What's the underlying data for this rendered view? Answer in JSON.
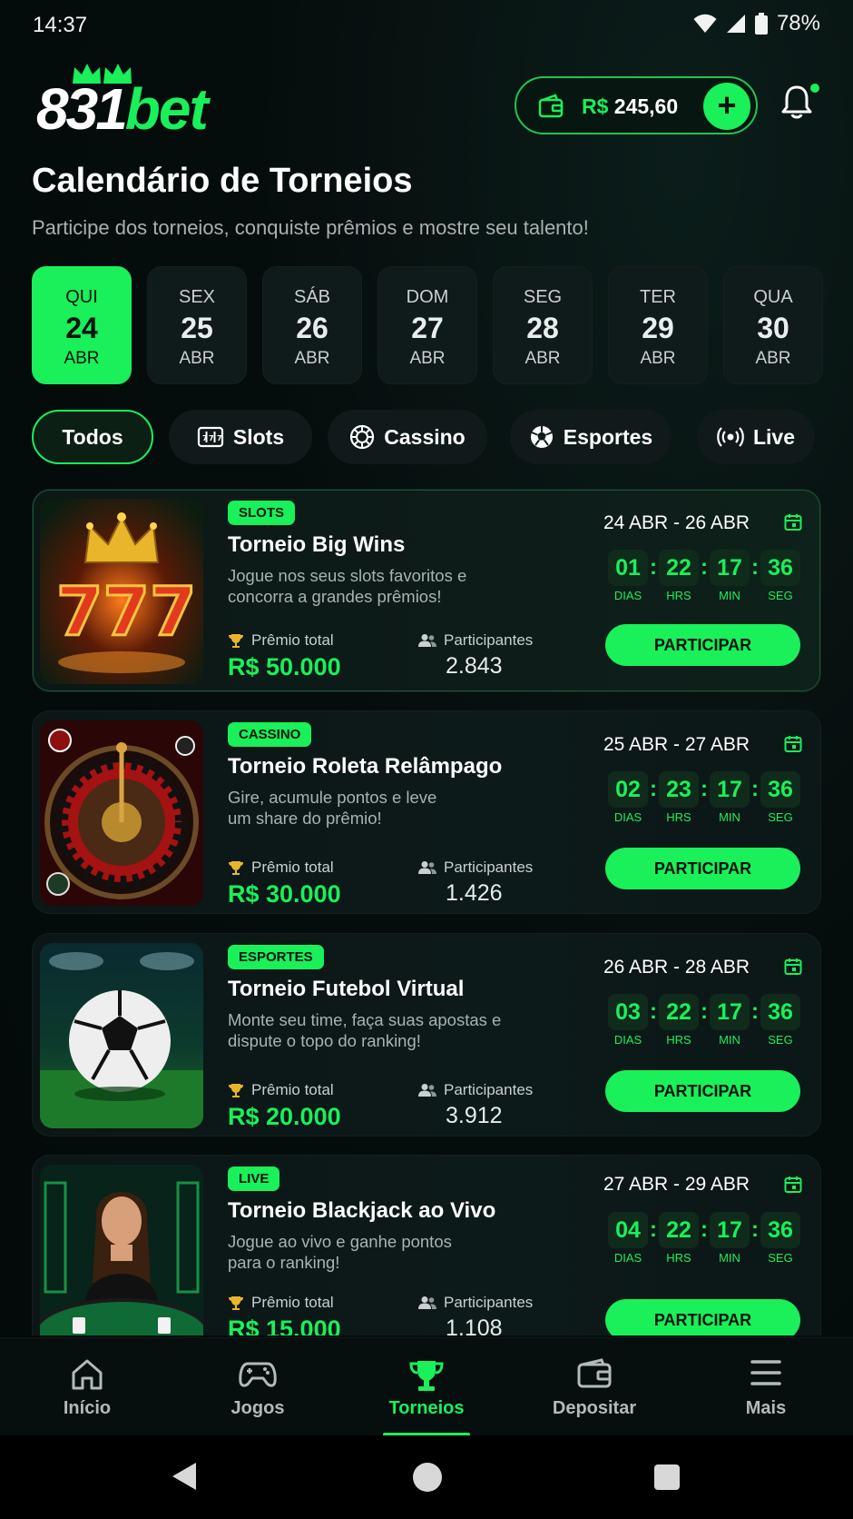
{
  "status_bar": {
    "time": "14:37",
    "battery": "78%"
  },
  "header": {
    "logo_number": "831",
    "logo_word": "bet",
    "balance_currency": "R$",
    "balance_value": "245,60",
    "add_label": "+"
  },
  "page": {
    "title": "Calendário de Torneios",
    "subtitle": "Participe dos torneios, conquiste prêmios e mostre seu talento!"
  },
  "dates": [
    {
      "dow": "QUI",
      "day": "24",
      "month": "ABR",
      "active": true
    },
    {
      "dow": "SEX",
      "day": "25",
      "month": "ABR",
      "active": false
    },
    {
      "dow": "SÁB",
      "day": "26",
      "month": "ABR",
      "active": false
    },
    {
      "dow": "DOM",
      "day": "27",
      "month": "ABR",
      "active": false
    },
    {
      "dow": "SEG",
      "day": "28",
      "month": "ABR",
      "active": false
    },
    {
      "dow": "TER",
      "day": "29",
      "month": "ABR",
      "active": false
    },
    {
      "dow": "QUA",
      "day": "30",
      "month": "ABR",
      "active": false
    }
  ],
  "filters": [
    {
      "label": "Todos",
      "icon": "none",
      "active": true
    },
    {
      "label": "Slots",
      "icon": "slot-machine-icon",
      "active": false
    },
    {
      "label": "Cassino",
      "icon": "casino-chip-icon",
      "active": false
    },
    {
      "label": "Esportes",
      "icon": "soccer-ball-icon",
      "active": false
    },
    {
      "label": "Live",
      "icon": "live-broadcast-icon",
      "active": false
    }
  ],
  "labels": {
    "prize": "Prêmio total",
    "participants": "Participantes",
    "join": "PARTICIPAR",
    "days": "DIAS",
    "hours": "HRS",
    "minutes": "MIN",
    "seconds": "SEG",
    "colon": ":"
  },
  "tournaments": [
    {
      "badge": "SLOTS",
      "name": "Torneio Big Wins",
      "desc": "Jogue nos seus slots favoritos e concorra a grandes prêmios!",
      "prize": "R$ 50.000",
      "participants": "2.843",
      "range": "24 ABR - 26 ABR",
      "timer": {
        "d": "01",
        "h": "22",
        "m": "17",
        "s": "36"
      },
      "thumb": "slots-777-crown-image"
    },
    {
      "badge": "CASSINO",
      "name": "Torneio Roleta Relâmpago",
      "desc": "Gire, acumule pontos e leve um share do prêmio!",
      "prize": "R$ 30.000",
      "participants": "1.426",
      "range": "25 ABR - 27 ABR",
      "timer": {
        "d": "02",
        "h": "23",
        "m": "17",
        "s": "36"
      },
      "thumb": "roulette-wheel-image"
    },
    {
      "badge": "ESPORTES",
      "name": "Torneio Futebol Virtual",
      "desc": "Monte seu time, faça suas apostas e dispute o topo do ranking!",
      "prize": "R$ 20.000",
      "participants": "3.912",
      "range": "26 ABR - 28 ABR",
      "timer": {
        "d": "03",
        "h": "22",
        "m": "17",
        "s": "36"
      },
      "thumb": "soccer-ball-stadium-image"
    },
    {
      "badge": "LIVE",
      "name": "Torneio Blackjack ao Vivo",
      "desc": "Jogue ao vivo e ganhe pontos para o ranking!",
      "prize": "R$ 15.000",
      "participants": "1.108",
      "range": "27 ABR - 29 ABR",
      "timer": {
        "d": "04",
        "h": "22",
        "m": "17",
        "s": "36"
      },
      "thumb": "live-dealer-blackjack-image"
    }
  ],
  "bottom_nav": [
    {
      "label": "Início",
      "icon": "home-icon",
      "active": false
    },
    {
      "label": "Jogos",
      "icon": "gamepad-icon",
      "active": false
    },
    {
      "label": "Torneios",
      "icon": "trophy-icon",
      "active": true
    },
    {
      "label": "Depositar",
      "icon": "wallet-icon",
      "active": false
    },
    {
      "label": "Mais",
      "icon": "menu-icon",
      "active": false
    }
  ],
  "colors": {
    "accent": "#19f05a",
    "background": "#050c0c",
    "card": "#0d1818"
  }
}
